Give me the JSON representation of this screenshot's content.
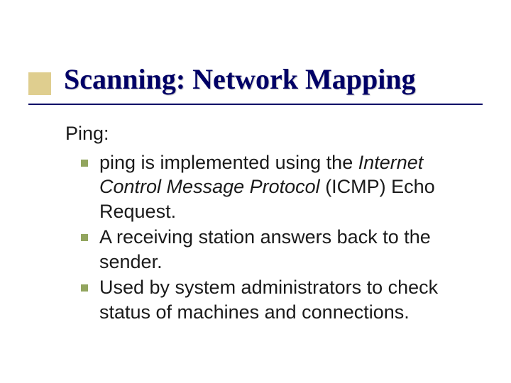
{
  "title": "Scanning: Network Mapping",
  "subhead": "Ping:",
  "bullets": {
    "b1": {
      "pre": "ping is implemented using the ",
      "ital_part1": "Internet ",
      "ital_C": "C",
      "ital_ontrol": "ontrol ",
      "ital_M": "M",
      "ital_essage": "essage ",
      "ital_P": "P",
      "ital_rotocol": "rotocol",
      "post": " (ICMP) Echo Request."
    },
    "b2": "A receiving station answers back to the sender.",
    "b3": "Used by system administrators to check status of machines and connections."
  },
  "accent_color": "#dfce8f",
  "title_color": "#000066",
  "bullet_color": "#92a55e"
}
